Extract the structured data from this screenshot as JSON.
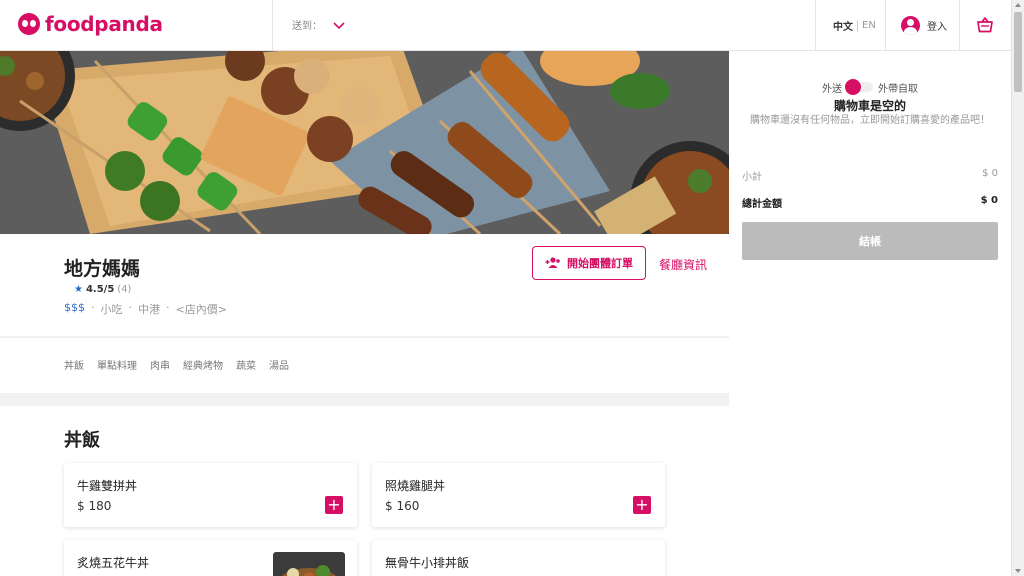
{
  "header": {
    "logo_text": "foodpanda",
    "deliver_label": "送到：",
    "lang_active": "中文",
    "lang_inactive": "EN",
    "login_label": "登入"
  },
  "restaurant": {
    "name": "地方媽媽",
    "rating_score": "4.5/5",
    "rating_count": "(4)",
    "price_level": "$$$",
    "tags": [
      "·",
      "小吃",
      "·",
      "中港",
      "·",
      "<店內價>"
    ],
    "group_order_label": "開始團體訂單",
    "info_link": "餐廳資訊"
  },
  "categories": [
    "丼飯",
    "單點料理",
    "肉串",
    "經典烤物",
    "蔬菜",
    "湯品"
  ],
  "menu": {
    "section_title": "丼飯",
    "items": [
      {
        "name": "牛雞雙拼丼",
        "price": "$ 180"
      },
      {
        "name": "照燒雞腿丼",
        "price": "$ 160"
      },
      {
        "name": "炙燒五花牛丼",
        "price": ""
      },
      {
        "name": "無骨牛小排丼飯",
        "price": ""
      }
    ],
    "add_symbol": "+"
  },
  "cart": {
    "delivery_label": "外送",
    "pickup_label": "外帶自取",
    "empty_title": "購物車是空的",
    "empty_text": "購物車還沒有任何物品，立即開始訂購喜愛的產品吧！",
    "subtotal_label": "小計",
    "subtotal_value": "$ 0",
    "total_label": "總計金額",
    "total_value": "$ 0",
    "checkout_label": "結帳"
  },
  "colors": {
    "brand": "#d70f64",
    "rating_star": "#2b6fc7",
    "checkout_disabled": "#bbbbbb"
  },
  "icons": [
    "panda-logo-icon",
    "chevron-down-icon",
    "user-icon",
    "basket-icon",
    "star-icon",
    "group-add-icon",
    "plus-icon"
  ]
}
